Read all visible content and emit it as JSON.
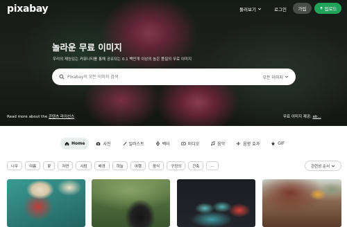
{
  "header": {
    "logo": "pixabay",
    "explore_label": "둘러보기",
    "login_label": "로그인",
    "join_label": "가입",
    "upload_label": "업로드"
  },
  "hero": {
    "title": "놀라운 무료 이미지",
    "subtitle": "우리의 재능있는 커뮤니티를 통해 공유되는 0.1 백만개 이상의 높은 품질의 무료 이미지",
    "search_placeholder": "Pixabay의 모든 이미지 검색",
    "search_filter": "모든 이미지",
    "learn_more_prefix": "Read more about the",
    "learn_more_link": "콘텐츠 라이선스",
    "credit_prefix": "무료 이미지 제공:",
    "credit_user": "ab..."
  },
  "tabs": [
    {
      "label": "Home",
      "icon": "home-icon"
    },
    {
      "label": "사진",
      "icon": "camera-icon"
    },
    {
      "label": "일러스트",
      "icon": "brush-icon"
    },
    {
      "label": "벡터",
      "icon": "vector-icon"
    },
    {
      "label": "비디오",
      "icon": "video-icon"
    },
    {
      "label": "음악",
      "icon": "music-icon"
    },
    {
      "label": "음향 효과",
      "icon": "sound-effect-icon"
    },
    {
      "label": "GIF",
      "icon": "gif-icon"
    }
  ],
  "chips": [
    "나무",
    "여름",
    "꽃",
    "자연",
    "사람",
    "배경",
    "하늘",
    "여행",
    "음식",
    "구정의",
    "건축",
    "..."
  ],
  "sort_label": "관련성 순서",
  "colors": {
    "accent_green": "#21a35a",
    "active_tab_bg": "#e8f0ee"
  }
}
